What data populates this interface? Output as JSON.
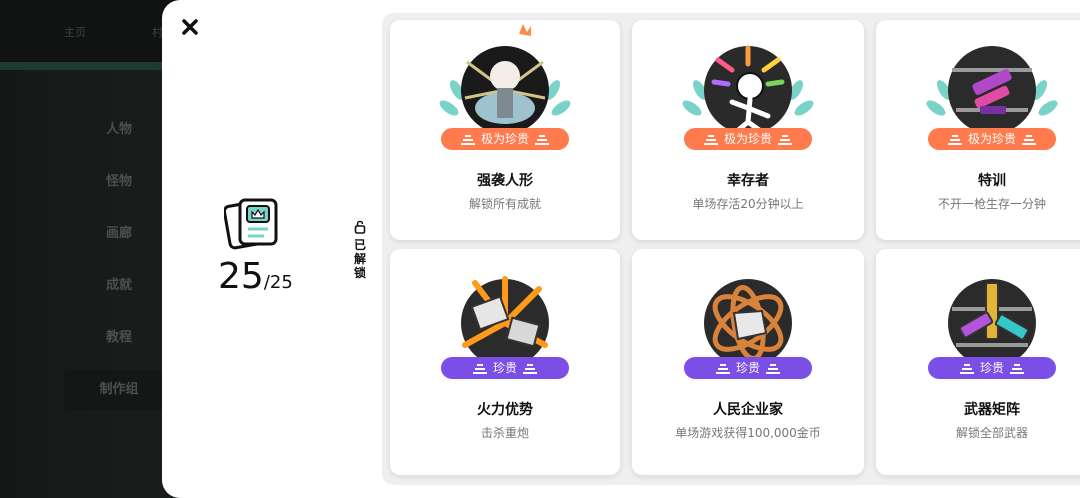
{
  "background_app": {
    "tabs": [
      "主页",
      "村"
    ],
    "menu": [
      "人物",
      "怪物",
      "画廊",
      "成就",
      "教程",
      "制作组"
    ]
  },
  "modal": {
    "close_icon": "close-icon",
    "counter": {
      "unlocked": "25",
      "total": "/25",
      "icon": "achievement-book-icon"
    },
    "unlocked_label": [
      "已",
      "解",
      "锁"
    ],
    "lock_icon": "unlock-icon"
  },
  "colors": {
    "rarity_very_rare": "#ff7a4c",
    "rarity_rare": "#7b4ee6"
  },
  "achievements": [
    {
      "title": "强袭人形",
      "description": "解锁所有成就",
      "rarity": "极为珍贵",
      "rarity_level": "very-rare",
      "icon": "assault-doll-icon"
    },
    {
      "title": "幸存者",
      "description": "单场存活20分钟以上",
      "rarity": "极为珍贵",
      "rarity_level": "very-rare",
      "icon": "survivor-icon"
    },
    {
      "title": "特训",
      "description": "不开一枪生存一分钟",
      "rarity": "极为珍贵",
      "rarity_level": "very-rare",
      "icon": "training-icon"
    },
    {
      "title": "火力优势",
      "description": "击杀重炮",
      "rarity": "珍贵",
      "rarity_level": "rare",
      "icon": "firepower-icon"
    },
    {
      "title": "人民企业家",
      "description": "单场游戏获得100,000金币",
      "rarity": "珍贵",
      "rarity_level": "rare",
      "icon": "entrepreneur-icon"
    },
    {
      "title": "武器矩阵",
      "description": "解锁全部武器",
      "rarity": "珍贵",
      "rarity_level": "rare",
      "icon": "weapon-matrix-icon"
    }
  ]
}
